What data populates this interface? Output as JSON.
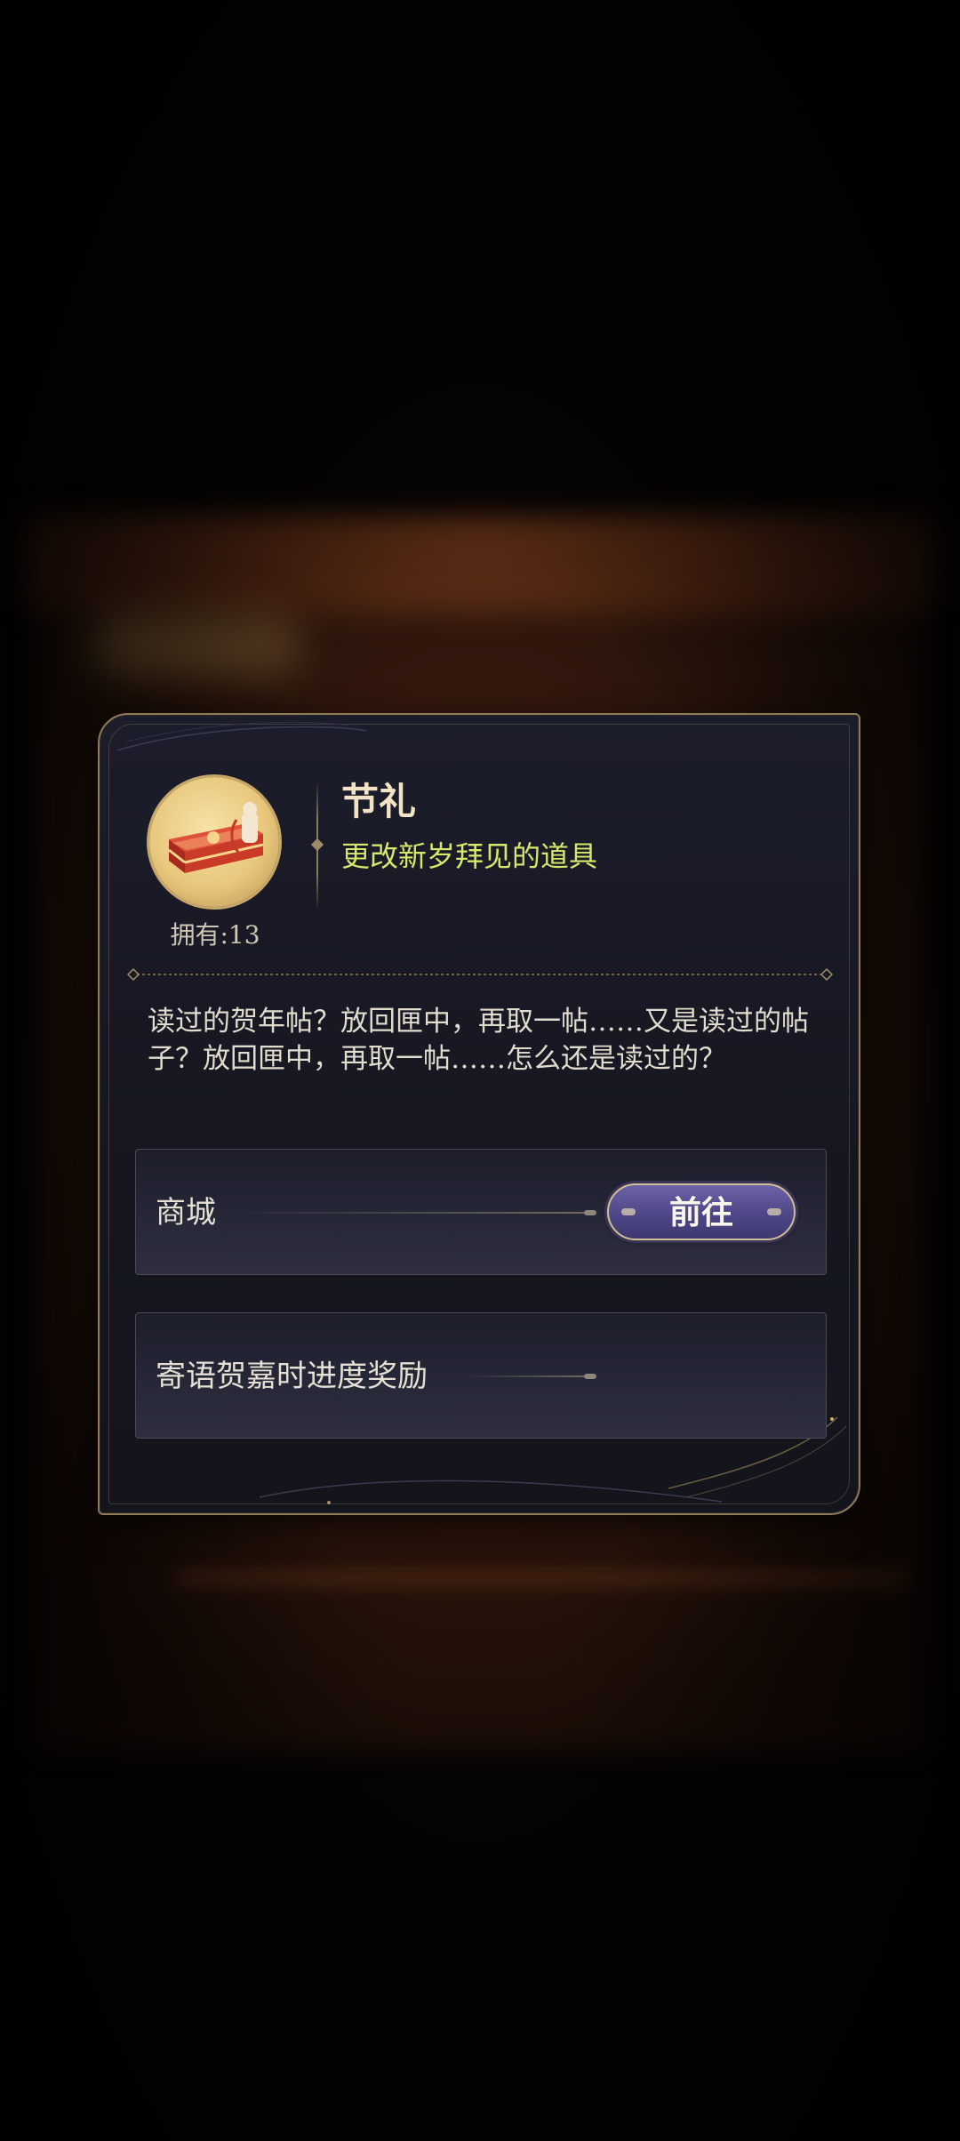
{
  "item": {
    "name": "节礼",
    "description": "更改新岁拜见的道具",
    "owned": "拥有:13",
    "flavor_text": "读过的贺年帖？放回匣中，再取一帖……又是读过的帖子？放回匣中，再取一帖……怎么还是读过的？",
    "icon": "gift-box-icon"
  },
  "sources": [
    {
      "label": "商城",
      "button_label": "前往"
    },
    {
      "label": "寄语贺嘉时进度奖励"
    }
  ],
  "colors": {
    "dialog_bg": "#1a1b27",
    "border_gold": "#8f7a5a",
    "description_green": "#d7e86a",
    "button_purple": "#4e4787"
  }
}
